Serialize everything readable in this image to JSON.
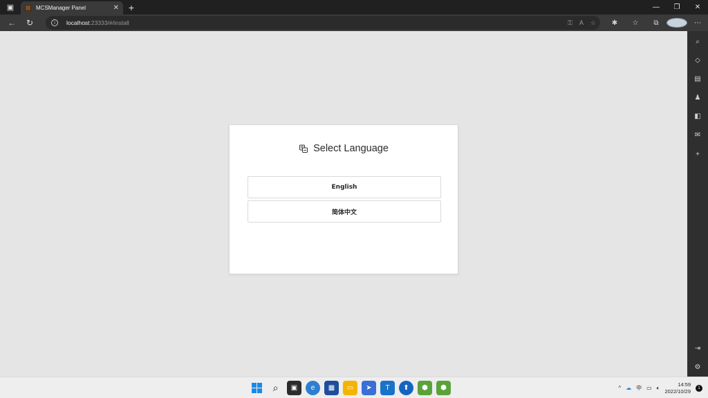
{
  "browser": {
    "tab_title": "MCSManager Panel",
    "tab_close": "✕",
    "new_tab": "+",
    "address_host": "localhost",
    "address_path": ":23333/#/install"
  },
  "window": {
    "minimize": "—",
    "restore": "❐",
    "close": "✕"
  },
  "page": {
    "title": "Select Language",
    "languages": [
      "English",
      "简体中文"
    ]
  },
  "tray": {
    "ime": "中",
    "time": "14:59",
    "date": "2022/10/29",
    "notification_count": "1"
  },
  "colors": {
    "page_bg": "#e5e5e5",
    "chrome_dark": "#202020",
    "toolbar": "#3a3a3a"
  }
}
